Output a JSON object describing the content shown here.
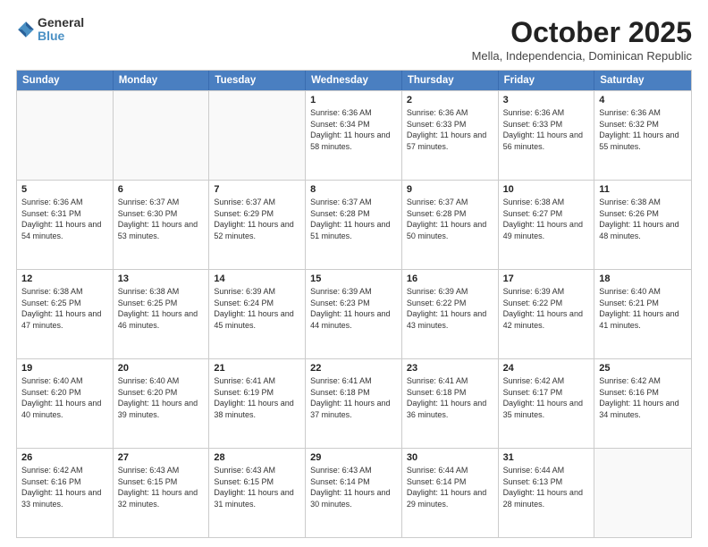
{
  "logo": {
    "general": "General",
    "blue": "Blue"
  },
  "header": {
    "month": "October 2025",
    "location": "Mella, Independencia, Dominican Republic"
  },
  "days": [
    "Sunday",
    "Monday",
    "Tuesday",
    "Wednesday",
    "Thursday",
    "Friday",
    "Saturday"
  ],
  "weeks": [
    [
      {
        "day": "",
        "text": ""
      },
      {
        "day": "",
        "text": ""
      },
      {
        "day": "",
        "text": ""
      },
      {
        "day": "1",
        "text": "Sunrise: 6:36 AM\nSunset: 6:34 PM\nDaylight: 11 hours and 58 minutes."
      },
      {
        "day": "2",
        "text": "Sunrise: 6:36 AM\nSunset: 6:33 PM\nDaylight: 11 hours and 57 minutes."
      },
      {
        "day": "3",
        "text": "Sunrise: 6:36 AM\nSunset: 6:33 PM\nDaylight: 11 hours and 56 minutes."
      },
      {
        "day": "4",
        "text": "Sunrise: 6:36 AM\nSunset: 6:32 PM\nDaylight: 11 hours and 55 minutes."
      }
    ],
    [
      {
        "day": "5",
        "text": "Sunrise: 6:36 AM\nSunset: 6:31 PM\nDaylight: 11 hours and 54 minutes."
      },
      {
        "day": "6",
        "text": "Sunrise: 6:37 AM\nSunset: 6:30 PM\nDaylight: 11 hours and 53 minutes."
      },
      {
        "day": "7",
        "text": "Sunrise: 6:37 AM\nSunset: 6:29 PM\nDaylight: 11 hours and 52 minutes."
      },
      {
        "day": "8",
        "text": "Sunrise: 6:37 AM\nSunset: 6:28 PM\nDaylight: 11 hours and 51 minutes."
      },
      {
        "day": "9",
        "text": "Sunrise: 6:37 AM\nSunset: 6:28 PM\nDaylight: 11 hours and 50 minutes."
      },
      {
        "day": "10",
        "text": "Sunrise: 6:38 AM\nSunset: 6:27 PM\nDaylight: 11 hours and 49 minutes."
      },
      {
        "day": "11",
        "text": "Sunrise: 6:38 AM\nSunset: 6:26 PM\nDaylight: 11 hours and 48 minutes."
      }
    ],
    [
      {
        "day": "12",
        "text": "Sunrise: 6:38 AM\nSunset: 6:25 PM\nDaylight: 11 hours and 47 minutes."
      },
      {
        "day": "13",
        "text": "Sunrise: 6:38 AM\nSunset: 6:25 PM\nDaylight: 11 hours and 46 minutes."
      },
      {
        "day": "14",
        "text": "Sunrise: 6:39 AM\nSunset: 6:24 PM\nDaylight: 11 hours and 45 minutes."
      },
      {
        "day": "15",
        "text": "Sunrise: 6:39 AM\nSunset: 6:23 PM\nDaylight: 11 hours and 44 minutes."
      },
      {
        "day": "16",
        "text": "Sunrise: 6:39 AM\nSunset: 6:22 PM\nDaylight: 11 hours and 43 minutes."
      },
      {
        "day": "17",
        "text": "Sunrise: 6:39 AM\nSunset: 6:22 PM\nDaylight: 11 hours and 42 minutes."
      },
      {
        "day": "18",
        "text": "Sunrise: 6:40 AM\nSunset: 6:21 PM\nDaylight: 11 hours and 41 minutes."
      }
    ],
    [
      {
        "day": "19",
        "text": "Sunrise: 6:40 AM\nSunset: 6:20 PM\nDaylight: 11 hours and 40 minutes."
      },
      {
        "day": "20",
        "text": "Sunrise: 6:40 AM\nSunset: 6:20 PM\nDaylight: 11 hours and 39 minutes."
      },
      {
        "day": "21",
        "text": "Sunrise: 6:41 AM\nSunset: 6:19 PM\nDaylight: 11 hours and 38 minutes."
      },
      {
        "day": "22",
        "text": "Sunrise: 6:41 AM\nSunset: 6:18 PM\nDaylight: 11 hours and 37 minutes."
      },
      {
        "day": "23",
        "text": "Sunrise: 6:41 AM\nSunset: 6:18 PM\nDaylight: 11 hours and 36 minutes."
      },
      {
        "day": "24",
        "text": "Sunrise: 6:42 AM\nSunset: 6:17 PM\nDaylight: 11 hours and 35 minutes."
      },
      {
        "day": "25",
        "text": "Sunrise: 6:42 AM\nSunset: 6:16 PM\nDaylight: 11 hours and 34 minutes."
      }
    ],
    [
      {
        "day": "26",
        "text": "Sunrise: 6:42 AM\nSunset: 6:16 PM\nDaylight: 11 hours and 33 minutes."
      },
      {
        "day": "27",
        "text": "Sunrise: 6:43 AM\nSunset: 6:15 PM\nDaylight: 11 hours and 32 minutes."
      },
      {
        "day": "28",
        "text": "Sunrise: 6:43 AM\nSunset: 6:15 PM\nDaylight: 11 hours and 31 minutes."
      },
      {
        "day": "29",
        "text": "Sunrise: 6:43 AM\nSunset: 6:14 PM\nDaylight: 11 hours and 30 minutes."
      },
      {
        "day": "30",
        "text": "Sunrise: 6:44 AM\nSunset: 6:14 PM\nDaylight: 11 hours and 29 minutes."
      },
      {
        "day": "31",
        "text": "Sunrise: 6:44 AM\nSunset: 6:13 PM\nDaylight: 11 hours and 28 minutes."
      },
      {
        "day": "",
        "text": ""
      }
    ]
  ]
}
